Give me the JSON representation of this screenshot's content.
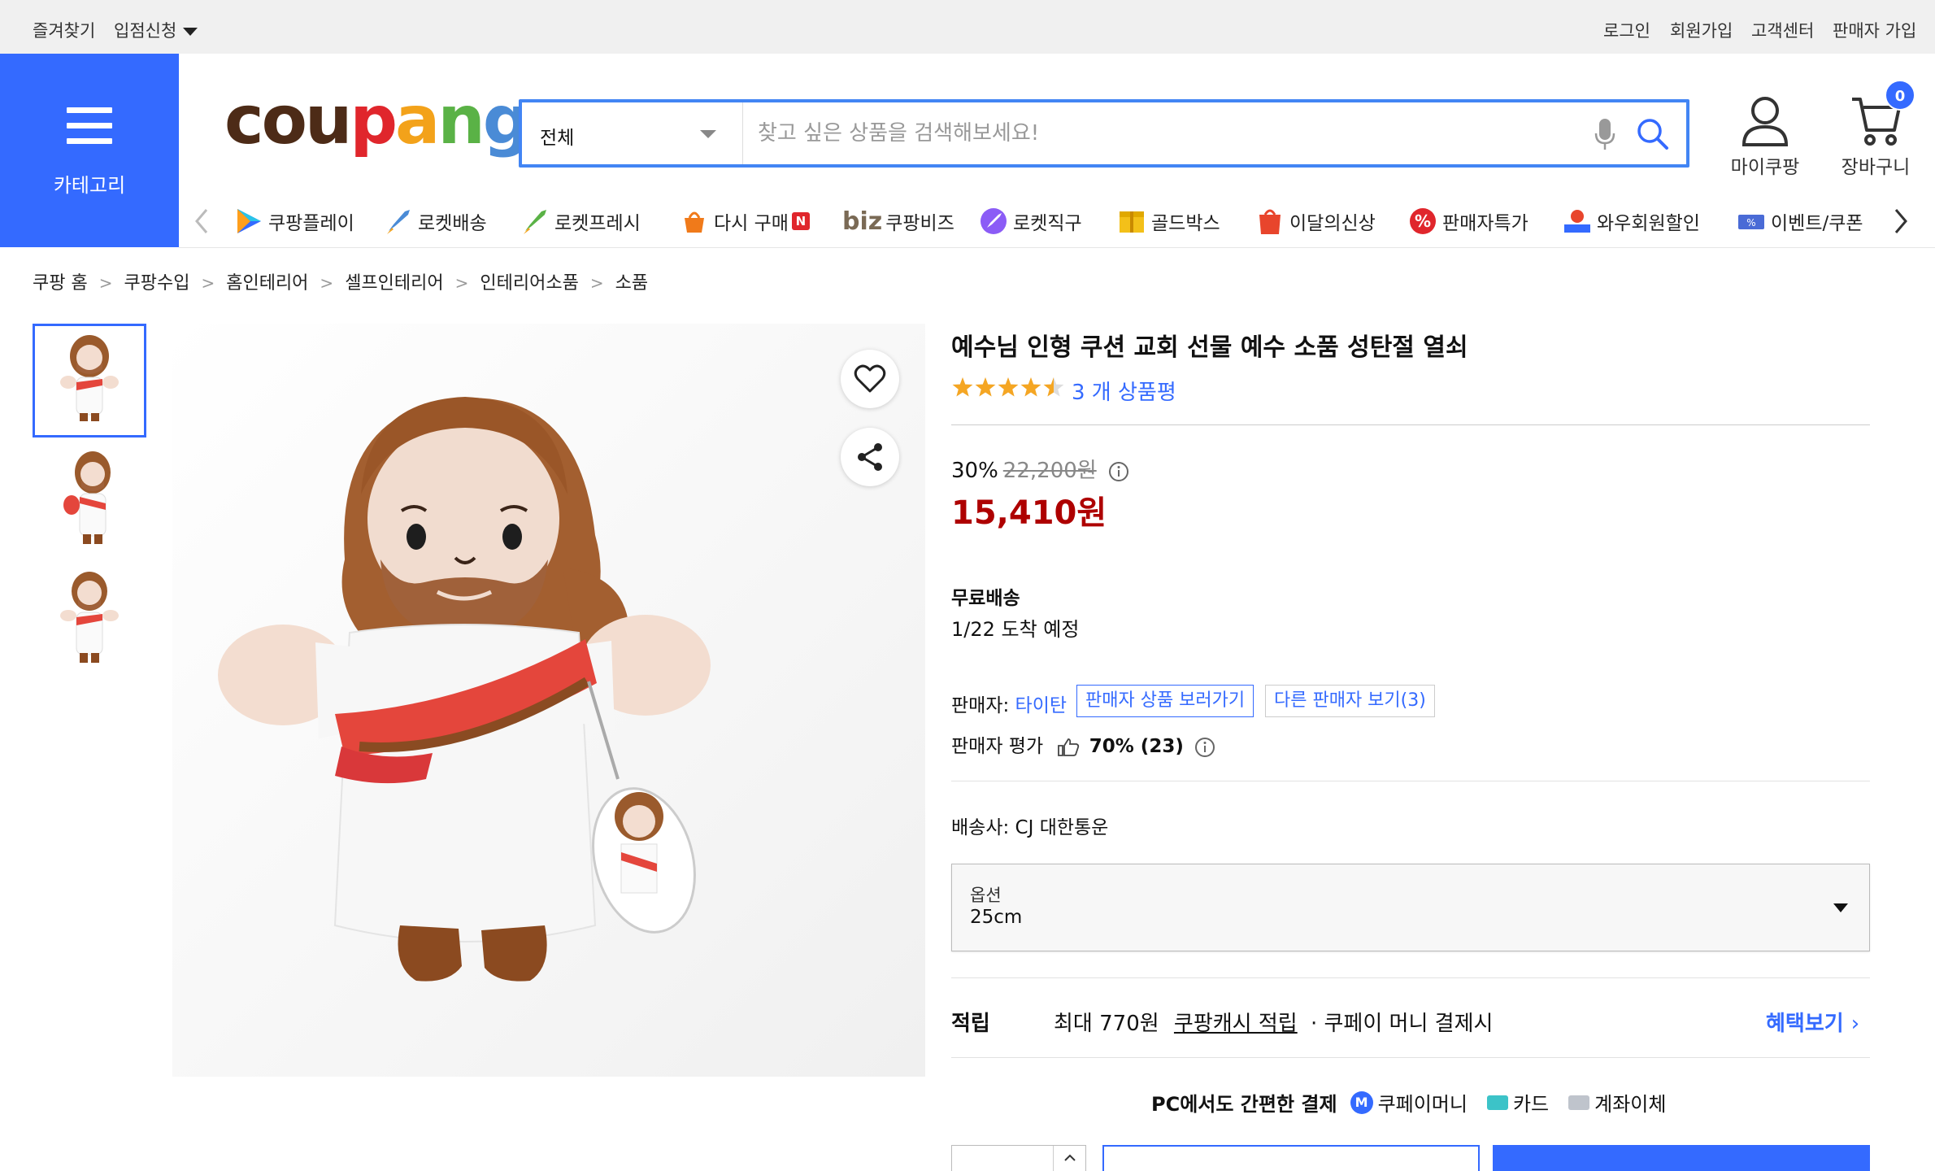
{
  "topbar": {
    "bookmark": "즐겨찾기",
    "partner": "입점신청",
    "login": "로그인",
    "signup": "회원가입",
    "service": "고객센터",
    "seller_signup": "판매자 가입"
  },
  "category": {
    "label": "카테고리"
  },
  "logo": {
    "letters": [
      "c",
      "o",
      "u",
      "p",
      "a",
      "n",
      "g"
    ],
    "colors": [
      "#4d2b17",
      "#4d2b17",
      "#4d2b17",
      "#e0262c",
      "#f3a21a",
      "#5ab246",
      "#4a8bd6"
    ]
  },
  "search": {
    "category": "전체",
    "placeholder": "찾고 싶은 상품을 검색해보세요!"
  },
  "header": {
    "mycoupang": "마이쿠팡",
    "cart": "장바구니",
    "cart_count": "0"
  },
  "shortcuts": [
    {
      "label": "쿠팡플레이",
      "icon": "coupang-play-icon"
    },
    {
      "label": "로켓배송",
      "icon": "rocket-icon"
    },
    {
      "label": "로켓프레시",
      "icon": "rocket-fresh-icon"
    },
    {
      "label": "다시 구매",
      "icon": "repurchase-icon",
      "badge": "N"
    },
    {
      "label": "쿠팡비즈",
      "icon": "biz-icon",
      "prefix": "biz"
    },
    {
      "label": "로켓직구",
      "icon": "rocket-global-icon"
    },
    {
      "label": "골드박스",
      "icon": "goldbox-icon"
    },
    {
      "label": "이달의신상",
      "icon": "new-icon"
    },
    {
      "label": "판매자특가",
      "icon": "seller-deal-icon"
    },
    {
      "label": "와우회원할인",
      "icon": "wow-icon"
    },
    {
      "label": "이벤트/쿠폰",
      "icon": "coupon-icon"
    }
  ],
  "breadcrumb": [
    "쿠팡 홈",
    "쿠팡수입",
    "홈인테리어",
    "셀프인테리어",
    "인테리어소품",
    "소품"
  ],
  "product": {
    "title": "예수님 인형 쿠션 교회 선물 예수 소품 성탄절 열쇠",
    "rating": 4.5,
    "review_count": "3 개 상품평",
    "discount": "30%",
    "original_price": "22,200원",
    "price": "15,410원",
    "shipping_title": "무료배송",
    "delivery": "1/22 도착 예정",
    "seller_label": "판매자:",
    "seller_name": "타이탄",
    "seller_products_btn": "판매자 상품 보러가기",
    "other_sellers_btn": "다른 판매자 보기(3)",
    "seller_rating_label": "판매자 평가",
    "seller_rating": "70% (23)",
    "carrier": "배송사:  CJ 대한통운",
    "option_label": "옵션",
    "option_value": "25cm",
    "reward_label": "적립",
    "reward_text": "최대 770원",
    "reward_link": "쿠팡캐시 적립",
    "reward_tail": "· 쿠페이 머니 결제시",
    "benefit_link": "혜택보기",
    "pay_title": "PC에서도 간편한 결제",
    "pay_money": "쿠페이머니",
    "pay_card": "카드",
    "pay_bank": "계좌이체"
  },
  "colors": {
    "accent": "#346aff",
    "price": "#ae0000",
    "star": "#f5a623"
  }
}
